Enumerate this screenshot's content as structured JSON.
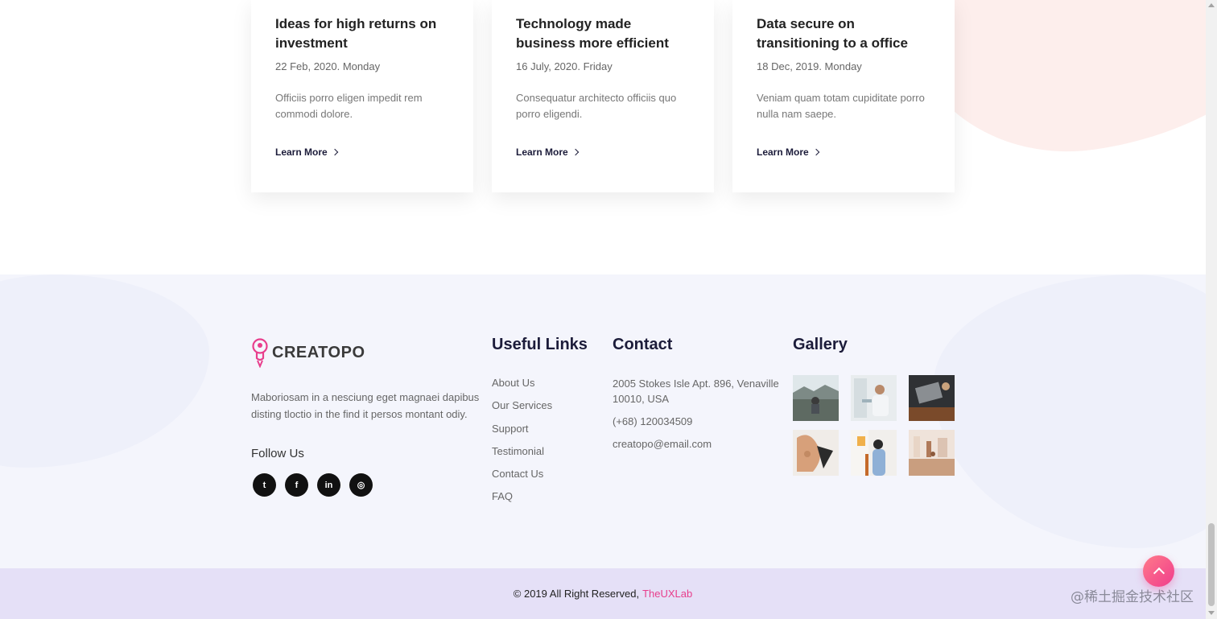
{
  "cards": [
    {
      "title": "Ideas for high returns on investment",
      "date": "22 Feb, 2020. Monday",
      "text": "Officiis porro eligen impedit rem commodi dolore.",
      "link": "Learn More"
    },
    {
      "title": "Technology made business more efficient",
      "date": "16 July, 2020. Friday",
      "text": "Consequatur architecto officiis quo porro eligendi.",
      "link": "Learn More"
    },
    {
      "title": "Data secure on transitioning to a office",
      "date": "18 Dec, 2019. Monday",
      "text": "Veniam quam totam cupiditate porro nulla nam saepe.",
      "link": "Learn More"
    }
  ],
  "footer": {
    "logo_text": "CREATOPO",
    "about": "Maboriosam in a nesciung eget magnaei dapibus disting tloctio in the find it persos montant odiy.",
    "follow_title": "Follow Us",
    "socials": [
      {
        "name": "twitter-icon",
        "glyph": "t"
      },
      {
        "name": "facebook-icon",
        "glyph": "f"
      },
      {
        "name": "linkedin-icon",
        "glyph": "in"
      },
      {
        "name": "dribbble-icon",
        "glyph": "◎"
      }
    ],
    "useful_links_title": "Useful Links",
    "useful_links": [
      "About Us",
      "Our Services",
      "Support",
      "Testimonial",
      "Contact Us",
      "FAQ"
    ],
    "contact_title": "Contact",
    "contact": {
      "address": "2005 Stokes Isle Apt. 896, Venaville 10010, USA",
      "phone": "(+68) 120034509",
      "email": "creatopo@email.com"
    },
    "gallery_title": "Gallery",
    "gallery": [
      "gallery-photo-lake",
      "gallery-photo-office",
      "gallery-photo-laptop",
      "gallery-photo-hands",
      "gallery-photo-woman",
      "gallery-photo-cafe"
    ]
  },
  "copyright": {
    "text": "© 2019 All Right Reserved,",
    "brand": "TheUXLab"
  },
  "watermark": "@稀土掘金技术社区",
  "colors": {
    "accent": "#e83e8c",
    "footer_bg": "#f4f5fc",
    "bottom_bar": "#e5e0f7"
  }
}
